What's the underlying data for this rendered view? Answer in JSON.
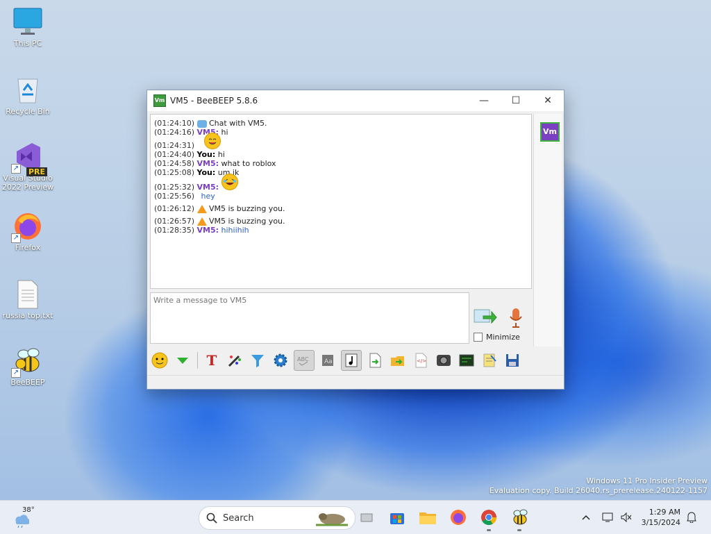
{
  "desktop": {
    "icons": [
      {
        "label": "This PC"
      },
      {
        "label": "Recycle Bin"
      },
      {
        "label": "Visual Studio 2022 Preview",
        "badge": "PRE"
      },
      {
        "label": "Firefox"
      },
      {
        "label": "russia top.txt"
      },
      {
        "label": "BeeBEEP"
      }
    ],
    "watermark": [
      "Windows 11 Pro Insider Preview",
      "Evaluation copy. Build 26040.rs_prerelease.240122-1157"
    ]
  },
  "window": {
    "title": "VM5 - BeeBEEP 5.8.6",
    "app_icon_text": "Vm",
    "controls": {
      "minimize": "—",
      "maximize": "☐",
      "close": "✕"
    },
    "messages": [
      {
        "time": "(01:24:10)",
        "kind": "system",
        "icon": "chat-bubble-icon",
        "text": "Chat with VM5."
      },
      {
        "time": "(01:24:16)",
        "sender": "VM5:",
        "text": "hi"
      },
      {
        "time": "(01:24:31)",
        "kind": "emoji",
        "icon": "yum-emoji-icon"
      },
      {
        "time": "(01:24:40)",
        "sender": "You:",
        "text": "hi"
      },
      {
        "time": "(01:24:58)",
        "sender": "VM5:",
        "text": "what to roblox"
      },
      {
        "time": "(01:25:08)",
        "sender": "You:",
        "text": "um ik"
      },
      {
        "time": "(01:25:32)",
        "sender": "VM5:",
        "icon": "laughing-emoji-icon"
      },
      {
        "time": "(01:25:56)",
        "text": "hey"
      },
      {
        "time": "(01:26:12)",
        "kind": "buzz",
        "icon": "bell-icon",
        "text": "VM5 is buzzing you."
      },
      {
        "time": "(01:26:57)",
        "kind": "buzz",
        "icon": "bell-icon",
        "text": "VM5 is buzzing you."
      },
      {
        "time": "(01:28:35)",
        "sender": "VM5:",
        "text": "hihiihih"
      }
    ],
    "input_placeholder": "Write a message to VM5",
    "minimize_label": "Minimize",
    "user_avatar": "Vm",
    "toolbar": [
      "smiley-icon",
      "green-arrow-icon",
      "font-icon",
      "color-icon",
      "filter-icon",
      "settings-gear-icon",
      "spellcheck-icon",
      "word-complete-icon",
      "music-note-icon",
      "send-file-icon",
      "folder-arrow-icon",
      "html-icon",
      "screenshot-icon",
      "terminal-icon",
      "notes-icon",
      "save-icon"
    ]
  },
  "taskbar": {
    "temperature": "38°",
    "search_label": "Search",
    "clock_time": "1:29 AM",
    "clock_date": "3/15/2024"
  },
  "colors": {
    "vm5_name": "#7b3fc2",
    "link_blue": "#2b5fc6",
    "accent_green": "#3cb23c"
  }
}
